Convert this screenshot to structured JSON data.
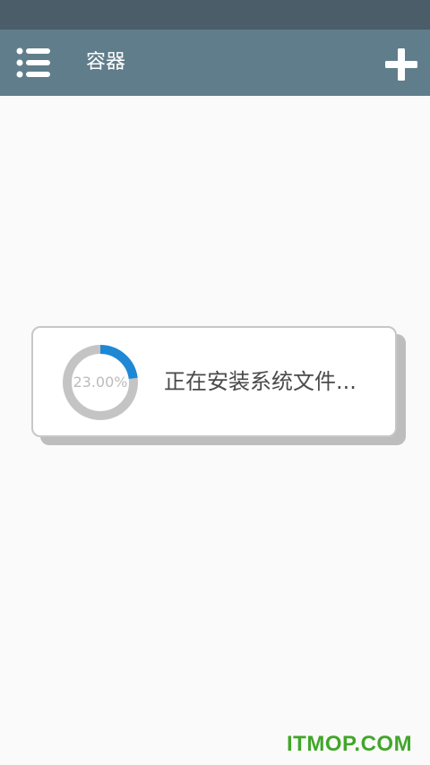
{
  "app_bar": {
    "title": "容器",
    "menu_icon": "list-icon",
    "add_icon": "plus-icon"
  },
  "dialog": {
    "progress": 0.23,
    "progress_label": "23.00%",
    "message": "正在安装系统文件..."
  },
  "watermark": {
    "text": "ITMOP.COM"
  },
  "colors": {
    "status_bar": "#4a5d68",
    "app_bar": "#607d8b",
    "progress_fill": "#1e88d5",
    "progress_track": "#c4c4c4",
    "watermark": "#41a62a"
  }
}
